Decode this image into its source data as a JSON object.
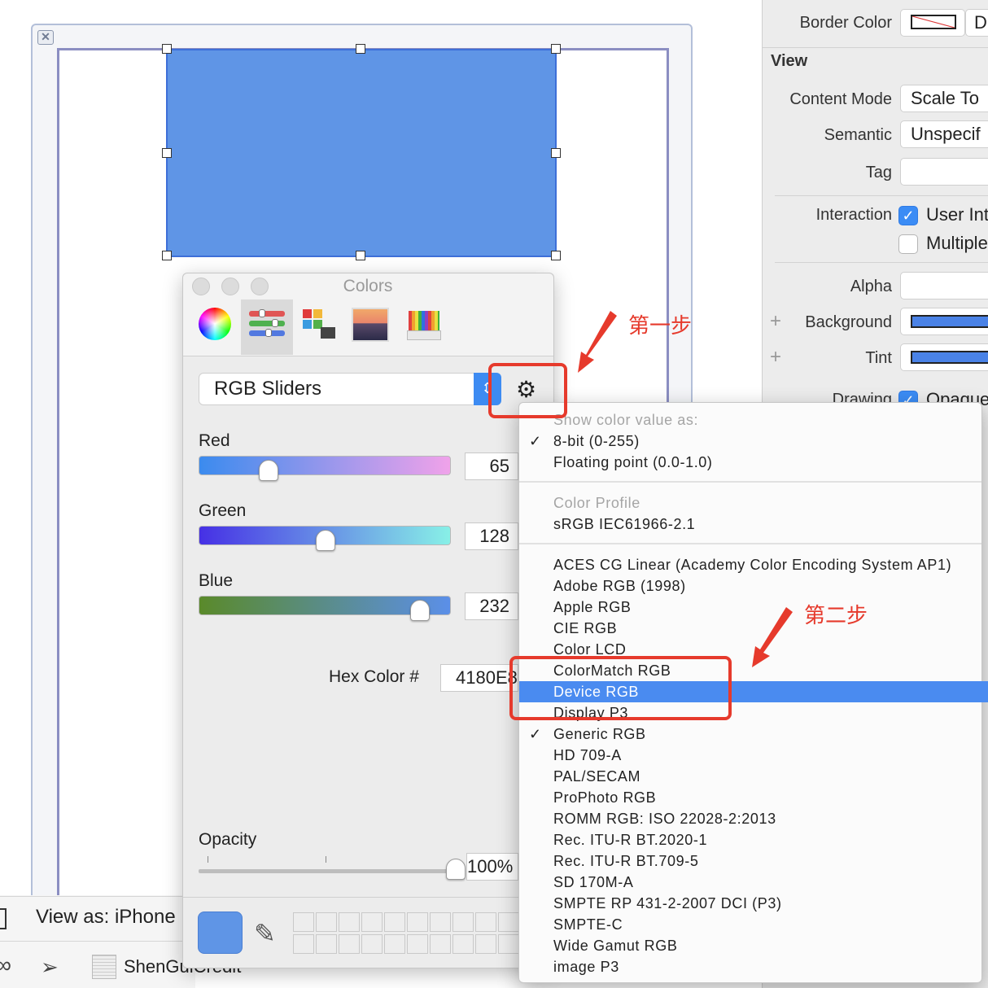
{
  "inspector": {
    "border_color_label": "Border Color",
    "border_color_value": "D",
    "section_title": "View",
    "content_mode_label": "Content Mode",
    "content_mode_value": "Scale To",
    "semantic_label": "Semantic",
    "semantic_value": "Unspecif",
    "tag_label": "Tag",
    "tag_value": "",
    "interaction_label": "Interaction",
    "user_interaction_label": "User Int",
    "multiple_touch_label": "Multiple",
    "alpha_label": "Alpha",
    "alpha_value": "",
    "background_label": "Background",
    "tint_label": "Tint",
    "drawing_label": "Drawing",
    "opaque_label": "Opaque",
    "background_color": "#4a82e6",
    "tint_color": "#4a82e6"
  },
  "canvas": {
    "view_as_text": "View as: iPhone",
    "project_name": "ShenGuiCredit",
    "view_color": "#5f95e6"
  },
  "colors_panel": {
    "title": "Colors",
    "mode_select_value": "RGB Sliders",
    "red_label": "Red",
    "red_value": "65",
    "red_fraction": 0.26,
    "green_label": "Green",
    "green_value": "128",
    "green_fraction": 0.502,
    "blue_label": "Blue",
    "blue_value": "232",
    "blue_fraction": 0.91,
    "hex_label": "Hex Color #",
    "hex_value": "4180E8",
    "opacity_label": "Opacity",
    "opacity_value": "100%",
    "opacity_fraction": 1.0,
    "swatch_color": "#5f95e6"
  },
  "menu": {
    "header_show": "Show color value as:",
    "items_value": [
      {
        "label": "8-bit (0-255)",
        "checked": true
      },
      {
        "label": "Floating point (0.0-1.0)",
        "checked": false
      }
    ],
    "header_profile": "Color Profile",
    "current_profile": "sRGB IEC61966-2.1",
    "profiles": [
      {
        "label": "ACES CG Linear (Academy Color Encoding System AP1)",
        "checked": false,
        "selected": false
      },
      {
        "label": "Adobe RGB (1998)",
        "checked": false,
        "selected": false
      },
      {
        "label": "Apple RGB",
        "checked": false,
        "selected": false
      },
      {
        "label": "CIE RGB",
        "checked": false,
        "selected": false
      },
      {
        "label": "Color LCD",
        "checked": false,
        "selected": false
      },
      {
        "label": "ColorMatch RGB",
        "checked": false,
        "selected": false
      },
      {
        "label": "Device RGB",
        "checked": false,
        "selected": true
      },
      {
        "label": "Display P3",
        "checked": false,
        "selected": false
      },
      {
        "label": "Generic RGB",
        "checked": true,
        "selected": false
      },
      {
        "label": "HD 709-A",
        "checked": false,
        "selected": false
      },
      {
        "label": "PAL/SECAM",
        "checked": false,
        "selected": false
      },
      {
        "label": "ProPhoto RGB",
        "checked": false,
        "selected": false
      },
      {
        "label": "ROMM RGB: ISO 22028-2:2013",
        "checked": false,
        "selected": false
      },
      {
        "label": "Rec. ITU-R BT.2020-1",
        "checked": false,
        "selected": false
      },
      {
        "label": "Rec. ITU-R BT.709-5",
        "checked": false,
        "selected": false
      },
      {
        "label": "SD 170M-A",
        "checked": false,
        "selected": false
      },
      {
        "label": "SMPTE RP 431-2-2007 DCI (P3)",
        "checked": false,
        "selected": false
      },
      {
        "label": "SMPTE-C",
        "checked": false,
        "selected": false
      },
      {
        "label": "Wide Gamut RGB",
        "checked": false,
        "selected": false
      },
      {
        "label": "image P3",
        "checked": false,
        "selected": false
      }
    ],
    "selection_color": "#4a8bf0"
  },
  "annotations": {
    "step1": "第一步",
    "step2": "第二步",
    "color": "#e63a2c"
  }
}
